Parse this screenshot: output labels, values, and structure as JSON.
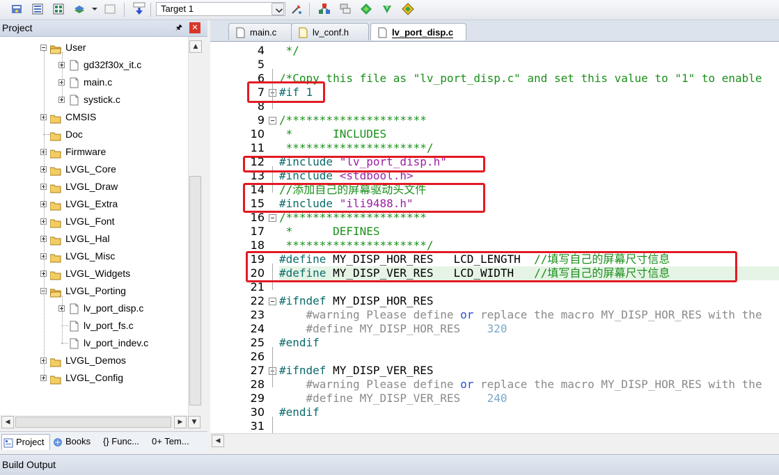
{
  "toolbar": {
    "target_select": "Target 1",
    "icons": [
      "options-icon",
      "batch-build-icon",
      "rebuild-icon",
      "manage-icon",
      "blank-icon",
      "load-icon",
      "target-options-icon",
      "select-packs-icon",
      "manage-project-icon",
      "components-icon",
      "pack-installer-icon",
      "event-recorder-icon"
    ]
  },
  "project_panel": {
    "title": "Project",
    "tree": [
      {
        "label": "User",
        "type": "folder",
        "expanded": true,
        "level": 1
      },
      {
        "label": "gd32f30x_it.c",
        "type": "file",
        "level": 2,
        "expandable": true
      },
      {
        "label": "main.c",
        "type": "file",
        "level": 2,
        "expandable": true
      },
      {
        "label": "systick.c",
        "type": "file",
        "level": 2,
        "expandable": true
      },
      {
        "label": "CMSIS",
        "type": "folder",
        "level": 1,
        "expandable": true
      },
      {
        "label": "Doc",
        "type": "folder",
        "level": 1,
        "expandable": false
      },
      {
        "label": "Firmware",
        "type": "folder",
        "level": 1,
        "expandable": true
      },
      {
        "label": "LVGL_Core",
        "type": "folder",
        "level": 1,
        "expandable": true
      },
      {
        "label": "LVGL_Draw",
        "type": "folder",
        "level": 1,
        "expandable": true
      },
      {
        "label": "LVGL_Extra",
        "type": "folder",
        "level": 1,
        "expandable": true
      },
      {
        "label": "LVGL_Font",
        "type": "folder",
        "level": 1,
        "expandable": true
      },
      {
        "label": "LVGL_Hal",
        "type": "folder",
        "level": 1,
        "expandable": true
      },
      {
        "label": "LVGL_Misc",
        "type": "folder",
        "level": 1,
        "expandable": true
      },
      {
        "label": "LVGL_Widgets",
        "type": "folder",
        "level": 1,
        "expandable": true
      },
      {
        "label": "LVGL_Porting",
        "type": "folder",
        "expanded": true,
        "level": 1
      },
      {
        "label": "lv_port_disp.c",
        "type": "file",
        "level": 2,
        "expandable": true
      },
      {
        "label": "lv_port_fs.c",
        "type": "file",
        "level": 2,
        "expandable": false
      },
      {
        "label": "lv_port_indev.c",
        "type": "file",
        "level": 2,
        "expandable": false
      },
      {
        "label": "LVGL_Demos",
        "type": "folder",
        "level": 1,
        "expandable": true
      },
      {
        "label": "LVGL_Config",
        "type": "folder",
        "level": 1,
        "expandable": true
      }
    ],
    "bottom_tabs": [
      "Project",
      "Books",
      "{} Func...",
      "0+ Tem..."
    ]
  },
  "editor": {
    "tabs": [
      {
        "label": "main.c",
        "active": false
      },
      {
        "label": "lv_conf.h",
        "active": false
      },
      {
        "label": "lv_port_disp.c",
        "active": true
      }
    ],
    "lines": [
      {
        "n": "4",
        "text": " */",
        "cls": "cm"
      },
      {
        "n": "5",
        "text": "",
        "cls": ""
      },
      {
        "n": "6",
        "text": "/*Copy this file as \"lv_port_disp.c\" and set this value to \"1\" to enable",
        "cls": "cm"
      },
      {
        "n": "7",
        "text": "#if 1",
        "cls": "pp",
        "fold": true
      },
      {
        "n": "8",
        "text": "",
        "cls": ""
      },
      {
        "n": "9",
        "text": "/*********************",
        "cls": "cm",
        "fold": true
      },
      {
        "n": "10",
        "text": " *      INCLUDES",
        "cls": "cm"
      },
      {
        "n": "11",
        "text": " *********************/",
        "cls": "cm"
      },
      {
        "n": "12",
        "text": "#include \"lv_port_disp.h\"",
        "cls": "inc"
      },
      {
        "n": "13",
        "text": "#include <stdbool.h>",
        "cls": "inc"
      },
      {
        "n": "14",
        "text": "//添加自己的屏幕驱动头文件",
        "cls": "cm"
      },
      {
        "n": "15",
        "text": "#include \"ili9488.h\"",
        "cls": "inc"
      },
      {
        "n": "16",
        "text": "/*********************",
        "cls": "cm",
        "fold": true
      },
      {
        "n": "17",
        "text": " *      DEFINES",
        "cls": "cm"
      },
      {
        "n": "18",
        "text": " *********************/",
        "cls": "cm"
      },
      {
        "n": "19",
        "text": "#define MY_DISP_HOR_RES   LCD_LENGTH  //填写自己的屏幕尺寸信息",
        "cls": "def"
      },
      {
        "n": "20",
        "text": "#define MY_DISP_VER_RES   LCD_WIDTH   //填写自己的屏幕尺寸信息",
        "cls": "def",
        "highlight": true
      },
      {
        "n": "21",
        "text": "",
        "cls": ""
      },
      {
        "n": "22",
        "text": "#ifndef MY_DISP_HOR_RES",
        "cls": "pp",
        "fold": true
      },
      {
        "n": "23",
        "text": "    #warning Please define or replace the macro MY_DISP_HOR_RES with the",
        "cls": "warn"
      },
      {
        "n": "24",
        "text": "    #define MY_DISP_HOR_RES    320",
        "cls": "dimdef"
      },
      {
        "n": "25",
        "text": "#endif",
        "cls": "pp"
      },
      {
        "n": "26",
        "text": "",
        "cls": ""
      },
      {
        "n": "27",
        "text": "#ifndef MY_DISP_VER_RES",
        "cls": "pp",
        "fold": true
      },
      {
        "n": "28",
        "text": "    #warning Please define or replace the macro MY_DISP_HOR_RES with the",
        "cls": "warn"
      },
      {
        "n": "29",
        "text": "    #define MY_DISP_VER_RES    240",
        "cls": "dimdef"
      },
      {
        "n": "30",
        "text": "#endif",
        "cls": "pp"
      },
      {
        "n": "31",
        "text": "",
        "cls": ""
      }
    ]
  },
  "build_output": {
    "title": "Build Output"
  },
  "colors": {
    "annotation_red": "#e21a23",
    "comment_green": "#1a8f1a",
    "string_purple": "#9b1fa3",
    "keyword_blue": "#2a4cd9",
    "line_highlight": "#e6f4e6"
  }
}
